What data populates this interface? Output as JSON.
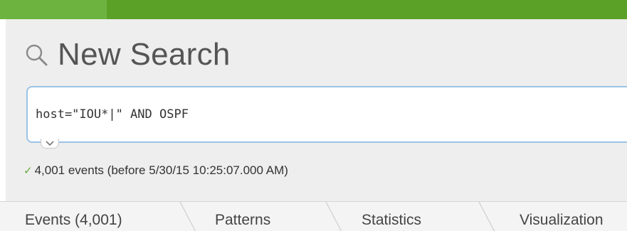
{
  "header": {
    "title": "New Search",
    "title_icon": "search-icon"
  },
  "search": {
    "query": "host=\"IOU*|\" AND OSPF",
    "expand_icon": "chevron-down-icon"
  },
  "status": {
    "icon": "check-icon",
    "text": "4,001 events (before 5/30/15 10:25:07.000 AM)"
  },
  "tabs": [
    {
      "label": "Events (4,001)"
    },
    {
      "label": "Patterns"
    },
    {
      "label": "Statistics"
    },
    {
      "label": "Visualization"
    }
  ],
  "colors": {
    "topbar": "#5ba128",
    "search_border": "#9cc3e6",
    "success": "#65a637"
  }
}
